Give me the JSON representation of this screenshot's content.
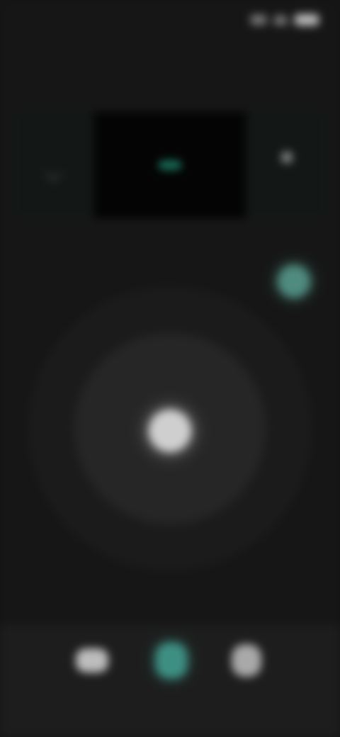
{
  "status_bar": {
    "time": "",
    "icons": [
      "signal-icon",
      "wifi-icon",
      "battery-icon"
    ]
  },
  "header": {
    "title": ""
  },
  "mode_panel": {
    "left_label": "",
    "current_value": "",
    "right_label": ""
  },
  "bottom_nav": {
    "items": [
      {
        "label": "",
        "icon": "first-nav-icon"
      },
      {
        "label": "",
        "icon": "active-nav-icon"
      },
      {
        "label": "",
        "icon": "third-nav-icon"
      }
    ]
  },
  "colors": {
    "accent": "#2fc79a",
    "background": "#161616",
    "panel_center": "#040404"
  }
}
